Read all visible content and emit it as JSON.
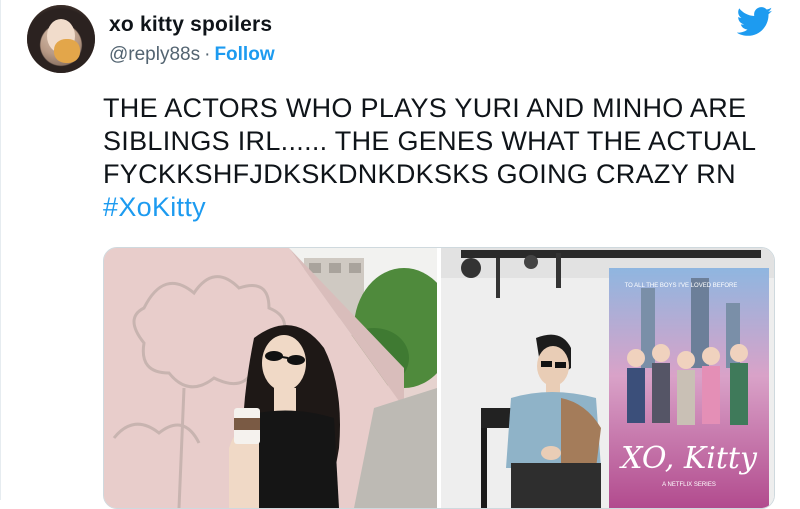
{
  "tweet": {
    "author": {
      "display_name": "xo kitty spoilers",
      "handle": "@reply88s",
      "separator": "·",
      "follow_label": "Follow",
      "avatar_icon": "profile-avatar"
    },
    "brand_icon": "twitter-bird-icon",
    "text_lines": [
      "THE ACTORS WHO PLAYS YURI AND MINHO ARE",
      "SIBLINGS IRL...... THE GENES WHAT THE ACTUAL",
      "FYCKKSHFJDKSKDNKDKSKS GOING CRAZY RN"
    ],
    "hashtag": "#XoKitty",
    "media": {
      "poster_title": "XO, Kitty",
      "poster_tagline": "TO ALL THE BOYS I'VE LOVED BEFORE",
      "poster_subtitle": "A NETFLIX SERIES"
    }
  },
  "colors": {
    "accent": "#1d9bf0",
    "text": "#0f1419",
    "muted": "#536471"
  }
}
